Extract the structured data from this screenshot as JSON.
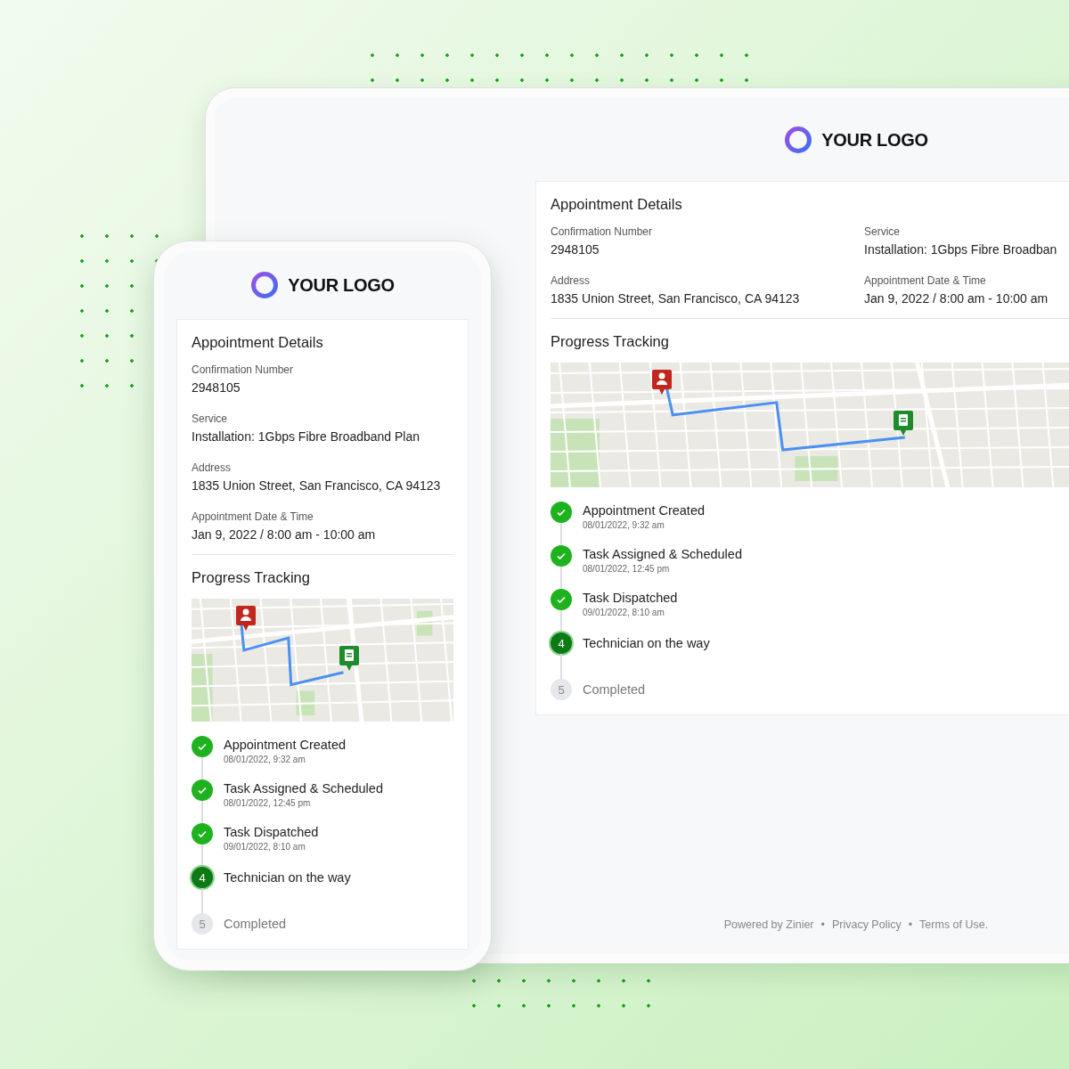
{
  "desktop": {
    "logo": "YOUR LOGO",
    "card": {
      "title": "Appointment Details",
      "fields": [
        {
          "label": "Confirmation Number",
          "value": "2948105"
        },
        {
          "label": "Service",
          "value": "Installation: 1Gbps Fibre Broadban"
        },
        {
          "label": "Address",
          "value": "1835 Union Street, San Francisco, CA 94123"
        },
        {
          "label": "Appointment Date & Time",
          "value": "Jan 9, 2022 / 8:00 am - 10:00 am"
        }
      ],
      "progress_title": "Progress Tracking",
      "steps": [
        {
          "title": "Appointment Created",
          "time": "08/01/2022, 9:32 am",
          "done": true,
          "current": false
        },
        {
          "title": "Task Assigned & Scheduled",
          "time": "08/01/2022, 12:45 pm",
          "done": true,
          "current": false
        },
        {
          "title": "Task Dispatched",
          "time": "09/01/2022, 8:10 am",
          "done": true,
          "current": false
        },
        {
          "title": "Technician on the way",
          "number": "4",
          "done": false,
          "current": true
        },
        {
          "title": "Completed",
          "number": "5",
          "done": false,
          "current": false
        }
      ]
    },
    "footer": {
      "items": [
        "Powered by Zinier",
        "Privacy Policy",
        "Terms of Use."
      ],
      "separator": "•"
    }
  },
  "phone": {
    "logo": "YOUR LOGO",
    "card": {
      "title": "Appointment Details",
      "fields": [
        {
          "label": "Confirmation Number",
          "value": "2948105"
        },
        {
          "label": "Service",
          "value": "Installation: 1Gbps Fibre Broadband Plan"
        },
        {
          "label": "Address",
          "value": "1835 Union Street, San Francisco, CA 94123"
        },
        {
          "label": "Appointment Date & Time",
          "value": "Jan 9, 2022 / 8:00 am - 10:00 am"
        }
      ],
      "progress_title": "Progress Tracking",
      "steps": [
        {
          "title": "Appointment Created",
          "time": "08/01/2022, 9:32 am",
          "done": true,
          "current": false
        },
        {
          "title": "Task Assigned & Scheduled",
          "time": "08/01/2022, 12:45 pm",
          "done": true,
          "current": false
        },
        {
          "title": "Task Dispatched",
          "time": "09/01/2022, 8:10 am",
          "done": true,
          "current": false
        },
        {
          "title": "Technician on the way",
          "number": "4",
          "done": false,
          "current": true
        },
        {
          "title": "Completed",
          "number": "5",
          "done": false,
          "current": false
        }
      ]
    }
  }
}
